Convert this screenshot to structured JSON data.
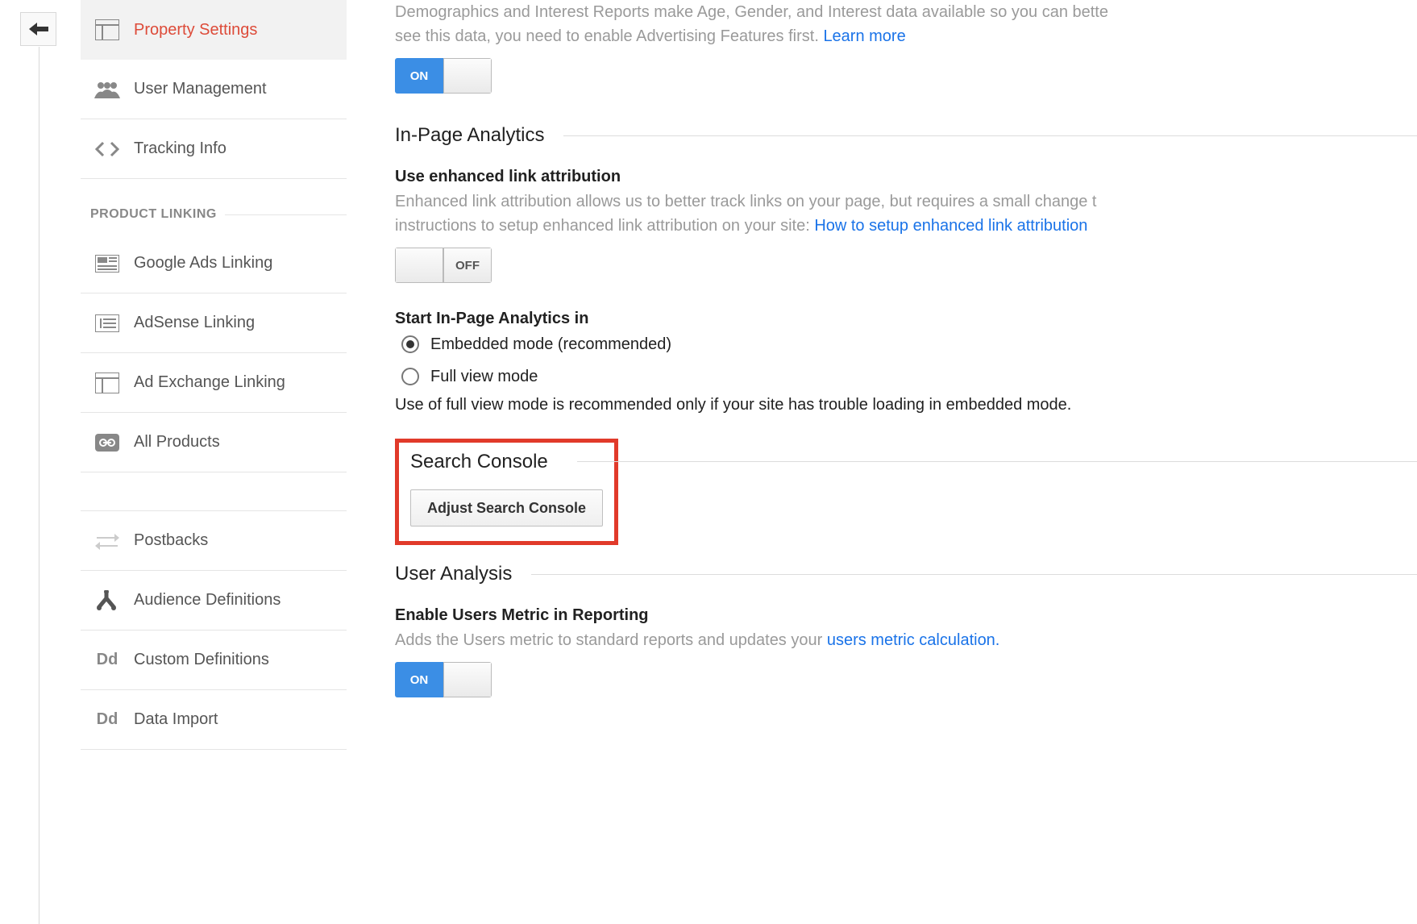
{
  "sidebar": {
    "items": [
      {
        "label": "Property Settings"
      },
      {
        "label": "User Management"
      },
      {
        "label": "Tracking Info"
      }
    ],
    "section_header": "PRODUCT LINKING",
    "product_items": [
      {
        "label": "Google Ads Linking"
      },
      {
        "label": "AdSense Linking"
      },
      {
        "label": "Ad Exchange Linking"
      },
      {
        "label": "All Products"
      }
    ],
    "other_items": [
      {
        "label": "Postbacks"
      },
      {
        "label": "Audience Definitions"
      },
      {
        "label": "Custom Definitions"
      },
      {
        "label": "Data Import"
      }
    ]
  },
  "demographics": {
    "desc_a": "Demographics and Interest Reports make Age, Gender, and Interest data available so you can bette",
    "desc_b": "see this data, you need to enable Advertising Features first. ",
    "learn_more": "Learn more",
    "toggle_on": "ON"
  },
  "inpage": {
    "heading": "In-Page Analytics",
    "enhanced_title": "Use enhanced link attribution",
    "enhanced_desc_a": "Enhanced link attribution allows us to better track links on your page, but requires a small change t",
    "enhanced_desc_b": "instructions to setup enhanced link attribution on your site: ",
    "enhanced_link": "How to setup enhanced link attribution",
    "toggle_off": "OFF",
    "start_title": "Start In-Page Analytics in",
    "radio_embedded": "Embedded mode (recommended)",
    "radio_full": "Full view mode",
    "full_note": "Use of full view mode is recommended only if your site has trouble loading in embedded mode."
  },
  "search_console": {
    "heading": "Search Console",
    "button": "Adjust Search Console"
  },
  "user_analysis": {
    "heading": "User Analysis",
    "enable_title": "Enable Users Metric in Reporting",
    "enable_desc": "Adds the Users metric to standard reports and updates your ",
    "enable_link": "users metric calculation.",
    "toggle_on": "ON"
  }
}
